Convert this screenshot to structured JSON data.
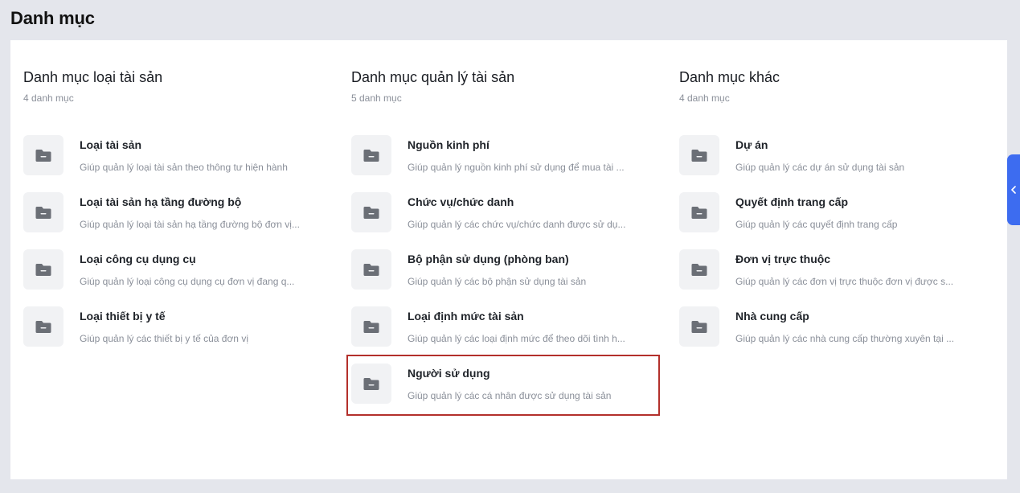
{
  "page": {
    "title": "Danh mục"
  },
  "colors": {
    "accent": "#3d6cf0",
    "highlight": "#b3302b",
    "icon_bg": "#f1f2f4",
    "icon_fg": "#6b6f76"
  },
  "columns": [
    {
      "title": "Danh mục loại tài sản",
      "count": "4 danh mục",
      "items": [
        {
          "title": "Loại tài sản",
          "desc": "Giúp quản lý loại tài sản theo thông tư hiện hành",
          "icon": "folder-icon"
        },
        {
          "title": "Loại tài sản hạ tầng đường bộ",
          "desc": "Giúp quản lý loại tài sản hạ tầng đường bộ đơn vị...",
          "icon": "folder-icon"
        },
        {
          "title": "Loại công cụ dụng cụ",
          "desc": "Giúp quản lý loại công cụ dụng cụ đơn vị đang q...",
          "icon": "folder-icon"
        },
        {
          "title": "Loại thiết bị y tế",
          "desc": "Giúp quản lý các thiết bị y tế của đơn vị",
          "icon": "folder-icon"
        }
      ]
    },
    {
      "title": "Danh mục quản lý tài sản",
      "count": "5 danh mục",
      "items": [
        {
          "title": "Nguồn kinh phí",
          "desc": "Giúp quản lý nguồn kinh phí sử dụng để mua tài ...",
          "icon": "folder-icon"
        },
        {
          "title": "Chức vụ/chức danh",
          "desc": "Giúp quản lý các chức vụ/chức danh được sử dụ...",
          "icon": "folder-icon"
        },
        {
          "title": "Bộ phận sử dụng (phòng ban)",
          "desc": "Giúp quản lý các bộ phận sử dụng tài sản",
          "icon": "folder-icon"
        },
        {
          "title": "Loại định mức tài sản",
          "desc": "Giúp quản lý các loại định mức để theo dõi tình h...",
          "icon": "folder-icon"
        },
        {
          "title": "Người sử dụng",
          "desc": "Giúp quản lý các cá nhân được sử dụng tài sản",
          "icon": "folder-icon"
        }
      ]
    },
    {
      "title": "Danh mục khác",
      "count": "4 danh mục",
      "items": [
        {
          "title": "Dự án",
          "desc": "Giúp quản lý các dự án sử dụng tài sản",
          "icon": "folder-icon"
        },
        {
          "title": "Quyết định trang cấp",
          "desc": "Giúp quản lý các quyết định trang cấp",
          "icon": "folder-icon"
        },
        {
          "title": "Đơn vị trực thuộc",
          "desc": "Giúp quản lý các đơn vị trực thuộc đơn vị được s...",
          "icon": "folder-icon"
        },
        {
          "title": "Nhà cung cấp",
          "desc": "Giúp quản lý các nhà cung cấp thường xuyên tại ...",
          "icon": "folder-icon"
        }
      ]
    }
  ],
  "side_toggle": {
    "icon": "chevron-left-icon"
  }
}
